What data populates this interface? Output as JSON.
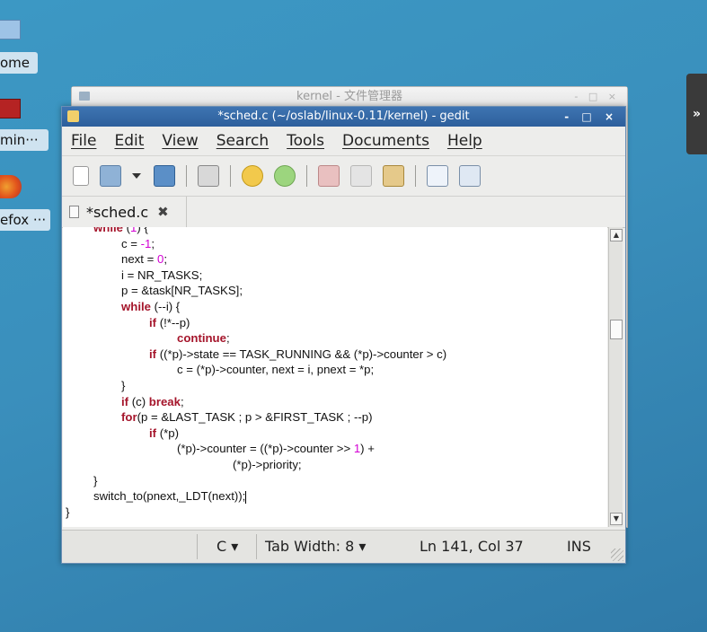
{
  "desktop": {
    "icons": [
      {
        "label": "ome"
      },
      {
        "label": "min···"
      },
      {
        "label": "efox ···"
      }
    ],
    "side_tab": "»"
  },
  "file_manager": {
    "title": "kernel - 文件管理器",
    "controls": "- □ ×"
  },
  "gedit": {
    "title": "*sched.c (~/oslab/linux-0.11/kernel) - gedit",
    "controls": "- □ ×",
    "menu": [
      "File",
      "Edit",
      "View",
      "Search",
      "Tools",
      "Documents",
      "Help"
    ],
    "tab": {
      "label": "*sched.c",
      "close": "✖"
    },
    "code_lines": [
      {
        "indent": 1,
        "parts": [
          [
            "kw",
            "while"
          ],
          [
            "t",
            " ("
          ],
          [
            "num",
            "1"
          ],
          [
            "t",
            ") {"
          ]
        ]
      },
      {
        "indent": 2,
        "parts": [
          [
            "t",
            "c = "
          ],
          [
            "num",
            "-1"
          ],
          [
            "t",
            ";"
          ]
        ]
      },
      {
        "indent": 2,
        "parts": [
          [
            "t",
            "next = "
          ],
          [
            "num",
            "0"
          ],
          [
            "t",
            ";"
          ]
        ]
      },
      {
        "indent": 2,
        "parts": [
          [
            "t",
            "i = NR_TASKS;"
          ]
        ]
      },
      {
        "indent": 2,
        "parts": [
          [
            "t",
            "p = &task[NR_TASKS];"
          ]
        ]
      },
      {
        "indent": 2,
        "parts": [
          [
            "kw",
            "while"
          ],
          [
            "t",
            " (--i) {"
          ]
        ]
      },
      {
        "indent": 3,
        "parts": [
          [
            "kw",
            "if"
          ],
          [
            "t",
            " (!*--p)"
          ]
        ]
      },
      {
        "indent": 4,
        "parts": [
          [
            "kw",
            "continue"
          ],
          [
            "t",
            ";"
          ]
        ]
      },
      {
        "indent": 3,
        "parts": [
          [
            "kw",
            "if"
          ],
          [
            "t",
            " ((*p)->state == TASK_RUNNING && (*p)->counter > c)"
          ]
        ]
      },
      {
        "indent": 4,
        "parts": [
          [
            "t",
            "c = (*p)->counter, next = i, pnext = *p;"
          ]
        ]
      },
      {
        "indent": 2,
        "parts": [
          [
            "t",
            "}"
          ]
        ]
      },
      {
        "indent": 2,
        "parts": [
          [
            "kw",
            "if"
          ],
          [
            "t",
            " (c) "
          ],
          [
            "kw",
            "break"
          ],
          [
            "t",
            ";"
          ]
        ]
      },
      {
        "indent": 2,
        "parts": [
          [
            "kw",
            "for"
          ],
          [
            "t",
            "(p = &LAST_TASK ; p > &FIRST_TASK ; --p)"
          ]
        ]
      },
      {
        "indent": 3,
        "parts": [
          [
            "kw",
            "if"
          ],
          [
            "t",
            " (*p)"
          ]
        ]
      },
      {
        "indent": 4,
        "parts": [
          [
            "t",
            "(*p)->counter = ((*p)->counter >> "
          ],
          [
            "num",
            "1"
          ],
          [
            "t",
            ") +"
          ]
        ]
      },
      {
        "indent": 6,
        "parts": [
          [
            "t",
            "(*p)->priority;"
          ]
        ]
      },
      {
        "indent": 1,
        "parts": [
          [
            "t",
            "}"
          ]
        ]
      },
      {
        "indent": 1,
        "parts": [
          [
            "t",
            "switch_to(pnext,_LDT(next));"
          ]
        ],
        "caret": true
      },
      {
        "indent": 0,
        "parts": [
          [
            "t",
            "}"
          ]
        ]
      }
    ],
    "status": {
      "language": "C ▾",
      "tab_width": "Tab Width:  8 ▾",
      "position": "Ln 141, Col 37",
      "mode": "INS"
    }
  }
}
